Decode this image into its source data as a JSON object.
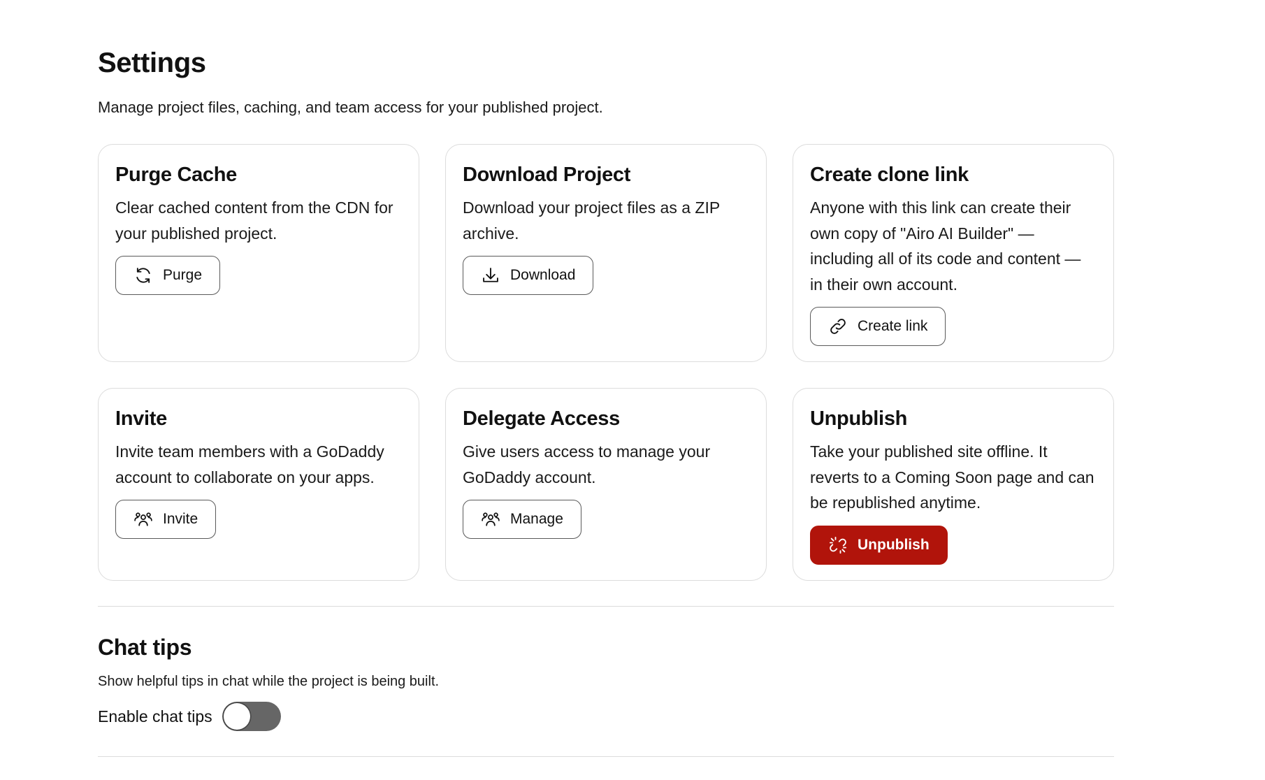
{
  "header": {
    "title": "Settings",
    "subtitle": "Manage project files, caching, and team access for your published project."
  },
  "cards": {
    "purge": {
      "title": "Purge Cache",
      "description": "Clear cached content from the CDN for your published project.",
      "button_label": "Purge",
      "icon": "refresh-icon"
    },
    "download": {
      "title": "Download Project",
      "description": "Download your project files as a ZIP archive.",
      "button_label": "Download",
      "icon": "download-icon"
    },
    "clone": {
      "title": "Create clone link",
      "description": "Anyone with this link can create their own copy of \"Airo AI Builder\" — including all of its code and content — in their own account.",
      "button_label": "Create link",
      "icon": "link-icon"
    },
    "invite": {
      "title": "Invite",
      "description": "Invite team members with a GoDaddy account to collaborate on your apps.",
      "button_label": "Invite",
      "icon": "users-icon"
    },
    "delegate": {
      "title": "Delegate Access",
      "description": "Give users access to manage your GoDaddy account.",
      "button_label": "Manage",
      "icon": "users-icon"
    },
    "unpublish": {
      "title": "Unpublish",
      "description": "Take your published site offline. It reverts to a Coming Soon page and can be republished anytime.",
      "button_label": "Unpublish",
      "icon": "broken-link-icon"
    }
  },
  "chat_tips": {
    "title": "Chat tips",
    "description": "Show helpful tips in chat while the project is being built.",
    "toggle_label": "Enable chat tips",
    "enabled": false
  },
  "colors": {
    "danger": "#b1140b",
    "toggle_off": "#666666",
    "border": "#dcdcdc"
  }
}
